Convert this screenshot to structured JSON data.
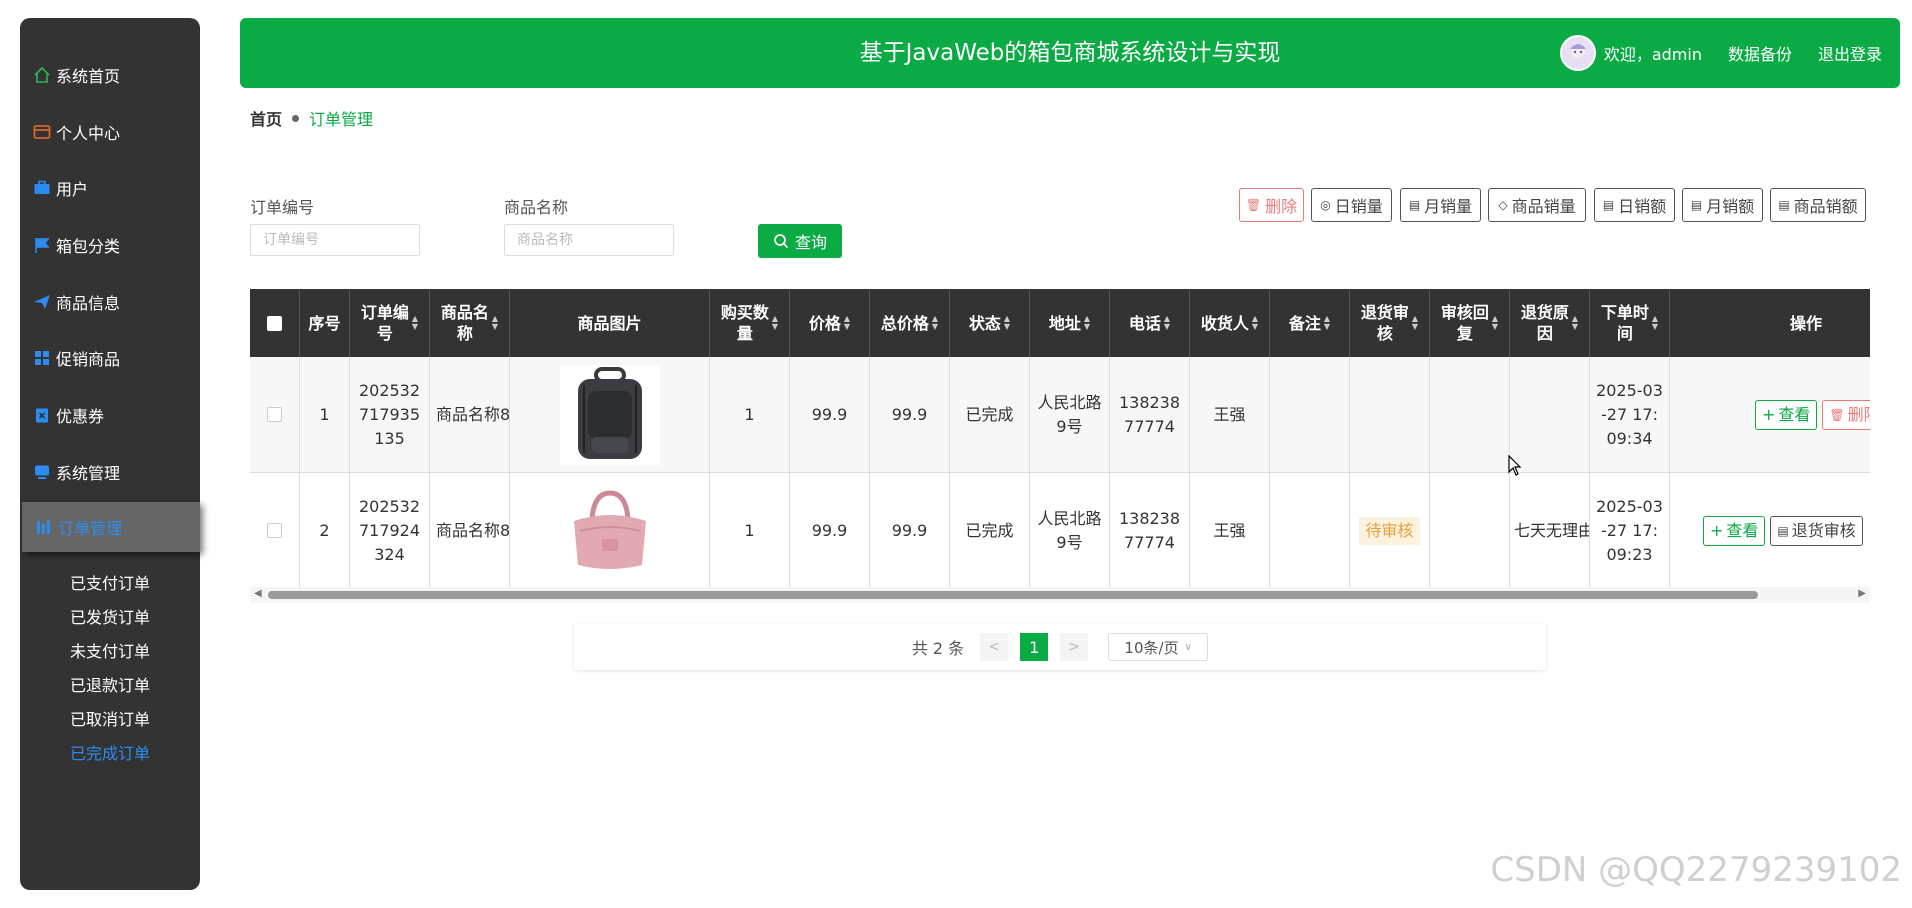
{
  "app": {
    "title": "基于JavaWeb的箱包商城系统设计与实现",
    "welcome": "欢迎，admin",
    "backup": "数据备份",
    "logout": "退出登录"
  },
  "sidebar": {
    "items": [
      {
        "label": "系统首页",
        "icon": "home-icon",
        "color": "#2fb74f"
      },
      {
        "label": "个人中心",
        "icon": "wallet-icon",
        "color": "#e8702a"
      },
      {
        "label": "用户",
        "icon": "briefcase-icon",
        "color": "#2d8cf0"
      },
      {
        "label": "箱包分类",
        "icon": "flag-icon",
        "color": "#2d8cf0"
      },
      {
        "label": "商品信息",
        "icon": "send-icon",
        "color": "#2d8cf0"
      },
      {
        "label": "促销商品",
        "icon": "grid-icon",
        "color": "#2d8cf0"
      },
      {
        "label": "优惠券",
        "icon": "clipboard-icon",
        "color": "#2d8cf0"
      },
      {
        "label": "系统管理",
        "icon": "monitor-icon",
        "color": "#2d8cf0"
      },
      {
        "label": "订单管理",
        "icon": "chart-icon",
        "color": "#2d8cf0"
      }
    ],
    "subitems": [
      "已支付订单",
      "已发货订单",
      "未支付订单",
      "已退款订单",
      "已取消订单",
      "已完成订单"
    ]
  },
  "breadcrumb": {
    "home": "首页",
    "current": "订单管理"
  },
  "search": {
    "order_no_label": "订单编号",
    "order_no_placeholder": "订单编号",
    "product_label": "商品名称",
    "product_placeholder": "商品名称",
    "query_label": "查询"
  },
  "toolbar": [
    "删除",
    "日销量",
    "月销量",
    "商品销量",
    "日销额",
    "月销额",
    "商品销额"
  ],
  "table": {
    "headers": [
      "序号",
      "订单编号",
      "商品名称",
      "商品图片",
      "购买数量",
      "价格",
      "总价格",
      "状态",
      "地址",
      "电话",
      "收货人",
      "备注",
      "退货审核",
      "审核回复",
      "退货原因",
      "下单时间",
      "操作"
    ],
    "rows": [
      {
        "index": "1",
        "order_no": "202532717935135",
        "product": "商品名称8",
        "qty": "1",
        "price": "99.9",
        "total": "99.9",
        "status": "已完成",
        "address": "人民北路9号",
        "phone": "13823877774",
        "receiver": "王强",
        "remark": "",
        "return_audit": "",
        "audit_reply": "",
        "return_reason": "",
        "order_time": "2025-03-27 17:09:34",
        "actions": [
          "查看",
          "删除"
        ]
      },
      {
        "index": "2",
        "order_no": "202532717924324",
        "product": "商品名称8",
        "qty": "1",
        "price": "99.9",
        "total": "99.9",
        "status": "已完成",
        "address": "人民北路9号",
        "phone": "13823877774",
        "receiver": "王强",
        "remark": "",
        "return_audit": "待审核",
        "audit_reply": "",
        "return_reason": "七天无理由",
        "order_time": "2025-03-27 17:09:23",
        "actions": [
          "查看",
          "退货审核"
        ]
      }
    ]
  },
  "pagination": {
    "total": "共 2 条",
    "prev": "<",
    "current": "1",
    "next": ">",
    "page_size": "10条/页"
  },
  "watermark": "CSDN @QQ2279239102"
}
